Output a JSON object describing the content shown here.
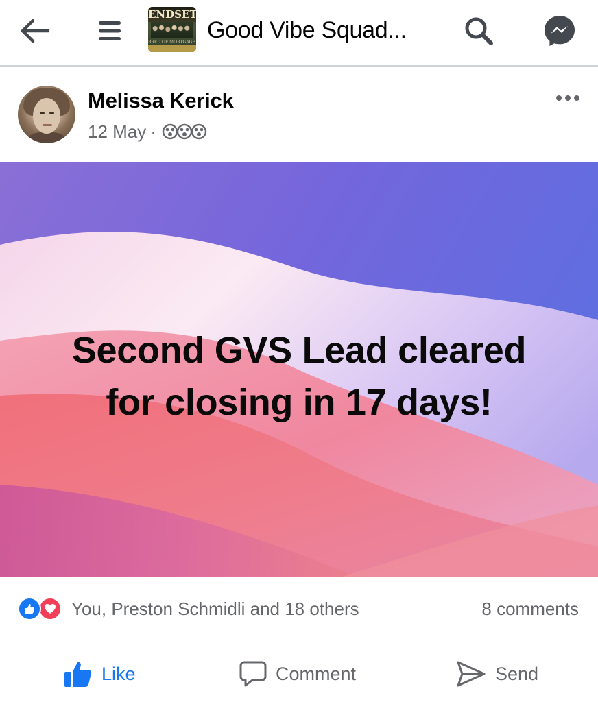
{
  "header": {
    "back_label": "back",
    "menu_label": "menu",
    "group_thumbnail": {
      "headline": "ENDSETT",
      "caption": "BRED OF MORTGAGE ADVI"
    },
    "group_title": "Good Vibe Squad...",
    "icons": [
      "back-arrow-icon",
      "hamburger-menu-icon",
      "search-icon",
      "messenger-icon"
    ]
  },
  "post": {
    "author": "Melissa Kerick",
    "date": "12 May",
    "separator": "·",
    "audience_icon": "members-icon",
    "more_icon": "more-horizontal-icon",
    "text_line_1": "Second GVS Lead cleared",
    "text_line_2": "for closing in 17 days!",
    "background_colors": {
      "purple": "#6f5fd9",
      "lavender": "#c7b6f0",
      "cream": "#f6e4ec",
      "pink": "#ee7fa3",
      "coral": "#f3867f",
      "magenta": "#c25ab8"
    }
  },
  "summary": {
    "reaction_icons": [
      "like-reaction-icon",
      "love-reaction-icon"
    ],
    "reactors": "You, Preston Schmidli and 18 others",
    "comments": "8 comments"
  },
  "actions": {
    "like": "Like",
    "comment": "Comment",
    "send": "Send"
  },
  "colors": {
    "accent_blue": "#1877f2",
    "love_red": "#f33e58",
    "secondary_text": "#65676b",
    "primary_text": "#050505",
    "divider": "#ced0d4"
  }
}
